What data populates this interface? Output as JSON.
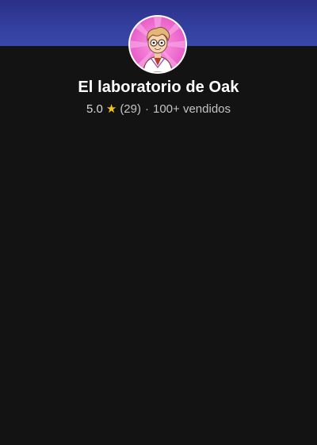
{
  "shop": {
    "name": "El laboratorio de Oak",
    "rating": "5.0",
    "reviews": "(29)",
    "separator": "·",
    "sales": "100+ vendidos"
  },
  "icons": {
    "star": "star-icon",
    "avatar": "cartoon-professor-avatar"
  },
  "colors": {
    "banner": "#3440a0",
    "background": "#131313",
    "avatar_bg": "#f07ad0",
    "star": "#f5c518"
  }
}
